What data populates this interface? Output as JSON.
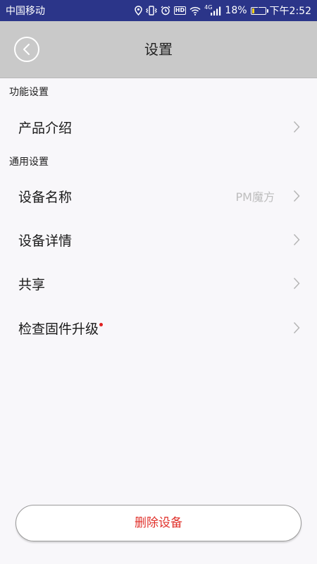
{
  "status_bar": {
    "carrier": "中国移动",
    "battery_percent": "18%",
    "battery_level": 0.18,
    "time": "下午2:52",
    "hd_label": "HD",
    "network_label": "4G",
    "icons": [
      "location-icon",
      "vibrate-icon",
      "alarm-icon",
      "hd-icon",
      "wifi-icon",
      "signal-icon",
      "battery-icon"
    ]
  },
  "header": {
    "title": "设置",
    "back_icon": "chevron-left-icon"
  },
  "sections": [
    {
      "title": "功能设置",
      "items": [
        {
          "label": "产品介绍",
          "value": "",
          "badge": false
        }
      ]
    },
    {
      "title": "通用设置",
      "items": [
        {
          "label": "设备名称",
          "value": "PM魔方",
          "badge": false
        },
        {
          "label": "设备详情",
          "value": "",
          "badge": false
        },
        {
          "label": "共享",
          "value": "",
          "badge": false
        },
        {
          "label": "检查固件升级",
          "value": "",
          "badge": true
        }
      ]
    }
  ],
  "delete_button": {
    "label": "删除设备"
  },
  "colors": {
    "status_bar_bg": "#2b3589",
    "header_bg": "#c9c9c9",
    "page_bg": "#f8f7fa",
    "delete_text": "#e0302a",
    "badge_dot": "#e02020",
    "value_text": "#bdbdbd"
  }
}
